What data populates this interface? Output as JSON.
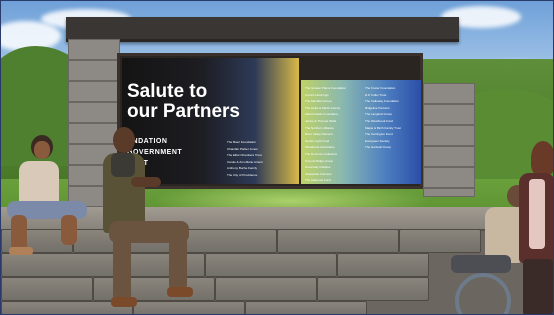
{
  "sign": {
    "title": "Salute to\nour Partners",
    "subtitle": "UNDATION\nGOVERNMENT\nPORT",
    "left_names": [
      "The Boeri Foundation",
      "Chandler Parker Jones",
      "The Elliot Chambers Trust",
      "Carole & Ann-Marie Arrenti",
      "Anthony Buche Family",
      "The City of Providence"
    ],
    "center_names": [
      "The Greater Plains Foundation",
      "Lincoln Hutchings",
      "The Meridian Group",
      "The Hollis & Martin Family",
      "Abbott Fields Foundation",
      "Janice & Thomas Wells",
      "The Northern Alliance",
      "River Valley Partners",
      "Harbor Light Fund",
      "Westbrook Associates",
      "The Dunmore Collective",
      "Summit Ridge Group",
      "Greenway Initiative",
      "Clearwater Partners",
      "The Oakmont Fund"
    ],
    "right_names": [
      "The Foster Foundation",
      "R.P. Fuller Trust",
      "The Calloway Foundation",
      "Ridgeline Partners",
      "The Langford Group",
      "The Westbrook Fund",
      "Maple & Birch Family Trust",
      "The Carrington Fund",
      "Evergreen Society",
      "The Hartwell Group"
    ]
  },
  "colors": {
    "sky": "#9cc0e6",
    "grass": "#5a8e2f",
    "sign_frame": "#2b2522",
    "stone": "#8a857c"
  }
}
